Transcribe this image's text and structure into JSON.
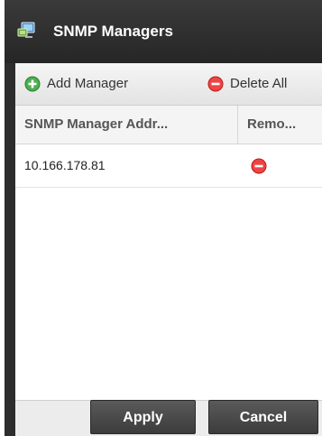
{
  "dialog": {
    "title": "SNMP Managers",
    "title_icon": "network-manager-icon"
  },
  "toolbar": {
    "add_label": "Add Manager",
    "add_icon": "add-circle-icon",
    "delete_all_label": "Delete All",
    "delete_all_icon": "remove-circle-icon"
  },
  "grid": {
    "columns": [
      {
        "label": "SNMP Manager Addr..."
      },
      {
        "label": "Remo..."
      }
    ],
    "rows": [
      {
        "address": "10.166.178.81",
        "remove_icon": "remove-circle-icon"
      }
    ]
  },
  "footer": {
    "apply_label": "Apply",
    "cancel_label": "Cancel"
  },
  "colors": {
    "title_bar": "#2d2d2d",
    "add_icon": "#4caf50",
    "remove_icon": "#e53935",
    "button": "#4a4a4a"
  }
}
